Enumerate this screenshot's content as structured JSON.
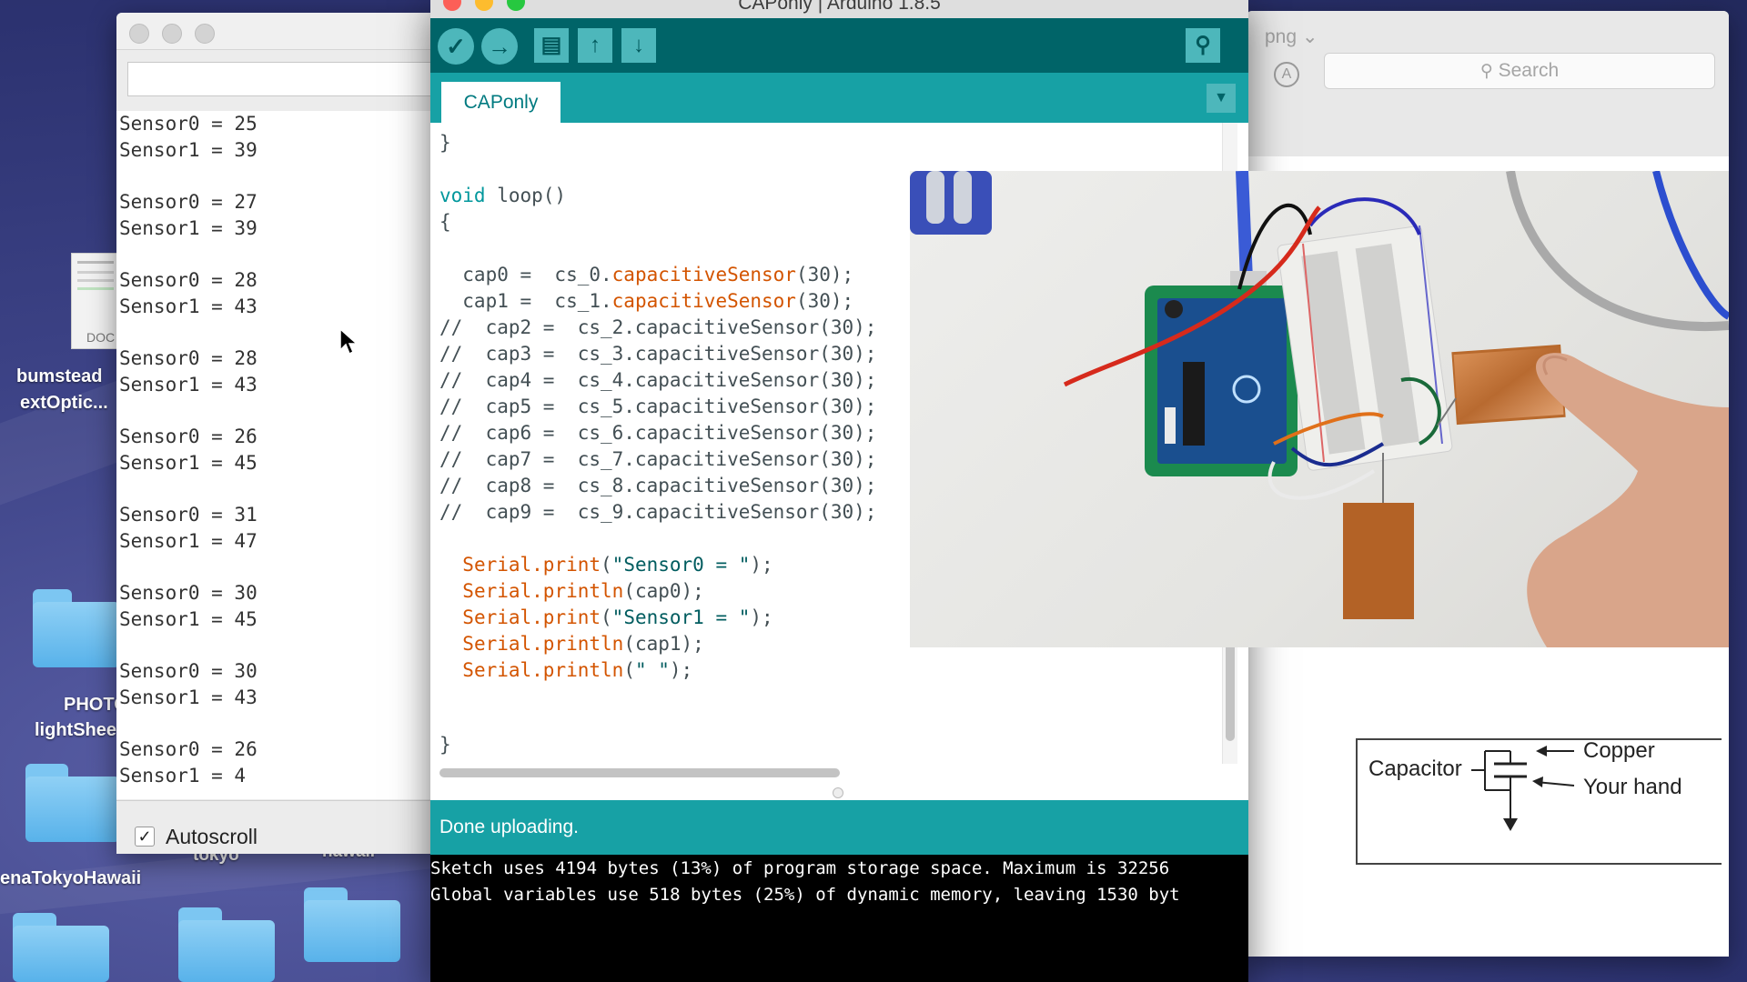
{
  "desktop": {
    "icons": [
      {
        "label_line1": "bumstead",
        "label_line2": "extOptic..."
      },
      {
        "label_line1": "PHOTOS",
        "label_line2": "lightShee"
      },
      {
        "label_line1": "enaTokyoHawaii"
      },
      {
        "label_line1": "tokyo"
      },
      {
        "label_line1": "hawaii"
      }
    ],
    "doc_thumb_label": "DOC"
  },
  "serial_monitor": {
    "lines": [
      "Sensor0 = 25",
      "Sensor1 = 39",
      "",
      "Sensor0 = 27",
      "Sensor1 = 39",
      "",
      "Sensor0 = 28",
      "Sensor1 = 43",
      "",
      "Sensor0 = 28",
      "Sensor1 = 43",
      "",
      "Sensor0 = 26",
      "Sensor1 = 45",
      "",
      "Sensor0 = 31",
      "Sensor1 = 47",
      "",
      "Sensor0 = 30",
      "Sensor1 = 45",
      "",
      "Sensor0 = 30",
      "Sensor1 = 43",
      "",
      "Sensor0 = 26",
      "Sensor1 = 4"
    ],
    "autoscroll_label": "Autoscroll",
    "autoscroll_checked": true
  },
  "ide": {
    "window_title": "CAPonly | Arduino 1.8.5",
    "tab_label": "CAPonly",
    "code": {
      "closing_brace_top": "}",
      "loop_kw": "void",
      "loop_name": " loop()",
      "open_brace": "{",
      "cap0": {
        "prefix": "  cap0 =  cs_0.",
        "fn": "capacitiveSensor",
        "suffix": "(30);"
      },
      "cap1": {
        "prefix": "  cap1 =  cs_1.",
        "fn": "capacitiveSensor",
        "suffix": "(30);"
      },
      "comments": [
        "//  cap2 =  cs_2.capacitiveSensor(30);",
        "//  cap3 =  cs_3.capacitiveSensor(30);",
        "//  cap4 =  cs_4.capacitiveSensor(30);",
        "//  cap5 =  cs_5.capacitiveSensor(30);",
        "//  cap6 =  cs_6.capacitiveSensor(30);",
        "//  cap7 =  cs_7.capacitiveSensor(30);",
        "//  cap8 =  cs_8.capacitiveSensor(30);",
        "//  cap9 =  cs_9.capacitiveSensor(30);"
      ],
      "serial_obj": "Serial",
      "print": ".print",
      "println": ".println",
      "s0_str": "\"Sensor0 = \"",
      "s1_str": "\"Sensor1 = \"",
      "space_str": "\" \"",
      "cap0_arg": "(cap0);",
      "cap1_arg": "(cap1);",
      "close_paren": ");",
      "open_paren": "(",
      "closing_brace_bottom": "}"
    },
    "status": "Done uploading.",
    "console": [
      "Sketch uses 4194 bytes (13%) of program storage space. Maximum is 32256",
      "Global variables use 518 bytes (25%) of dynamic memory, leaving 1530 byt"
    ]
  },
  "doc_window": {
    "title_fragment": "png ⌄",
    "search_placeholder": "Search",
    "diagram": {
      "capacitor_label": "Capacitor",
      "copper_label": "Copper",
      "hand_label": "Your hand"
    }
  }
}
